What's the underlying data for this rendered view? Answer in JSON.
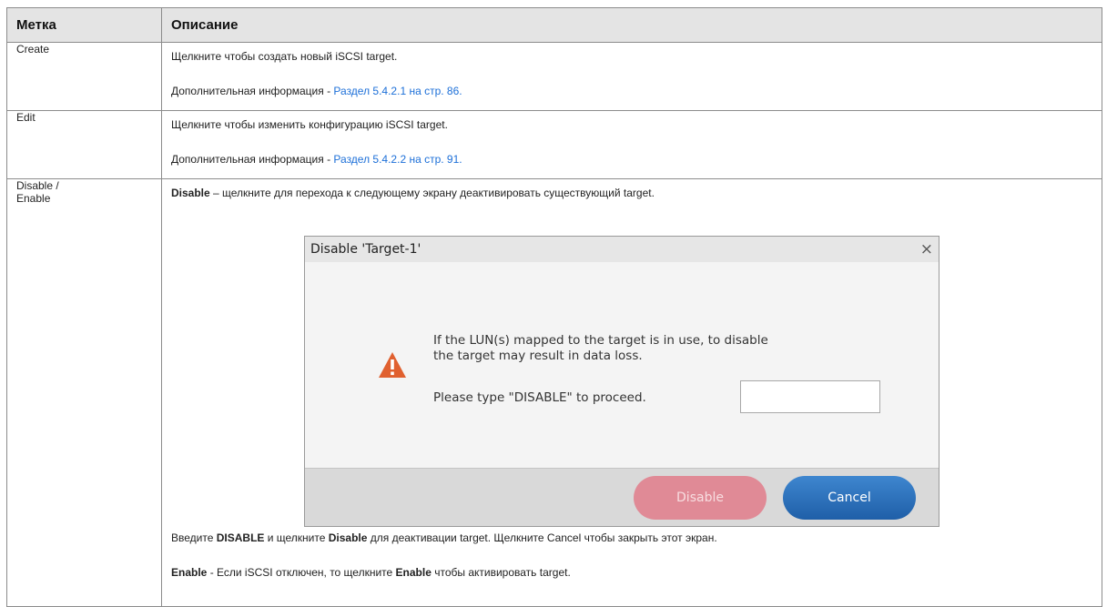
{
  "table": {
    "header_label": "Метка",
    "header_desc": "Описание",
    "rows": [
      {
        "label": "Create",
        "line1": "Щелкните чтобы создать новый iSCSI target.",
        "more_prefix": "Дополнительная информация - ",
        "more_link": "Раздел 5.4.2.1 на стр. 86."
      },
      {
        "label": "Edit",
        "line1": "Щелкните чтобы изменить конфигурацию iSCSI target.",
        "more_prefix": "Дополнительная информация - ",
        "more_link": "Раздел 5.4.2.2 на стр. 91."
      }
    ],
    "row3": {
      "label_a": "Disable /",
      "label_b": "Enable",
      "disable_bold": "Disable",
      "disable_text": " – щелкните для перехода к следующему экрану деактивировать существующий target.",
      "enter_1": "Введите ",
      "enter_bold1": "DISABLE",
      "enter_2": " и щелкните ",
      "enter_bold2": "Disable",
      "enter_3": " для деактивации target. Щелкните Cancel чтобы закрыть этот экран.",
      "enable_bold": "Enable",
      "enable_1": " - Если iSCSI отключен, то щелкните ",
      "enable_bold2": "Enable",
      "enable_2": " чтобы активировать target."
    }
  },
  "dialog": {
    "title": "Disable 'Target-1'",
    "close_glyph": "×",
    "message_line1": "If the LUN(s) mapped to the target is in use, to disable",
    "message_line2": "the target may result in data loss.",
    "prompt": "Please type \"DISABLE\" to proceed.",
    "input_value": "",
    "disable_label": "Disable",
    "cancel_label": "Cancel",
    "icon": "warning-icon",
    "colors": {
      "warning": "#e0602f",
      "disable_btn": "#e08a96",
      "cancel_btn": "#2f72bd"
    }
  }
}
